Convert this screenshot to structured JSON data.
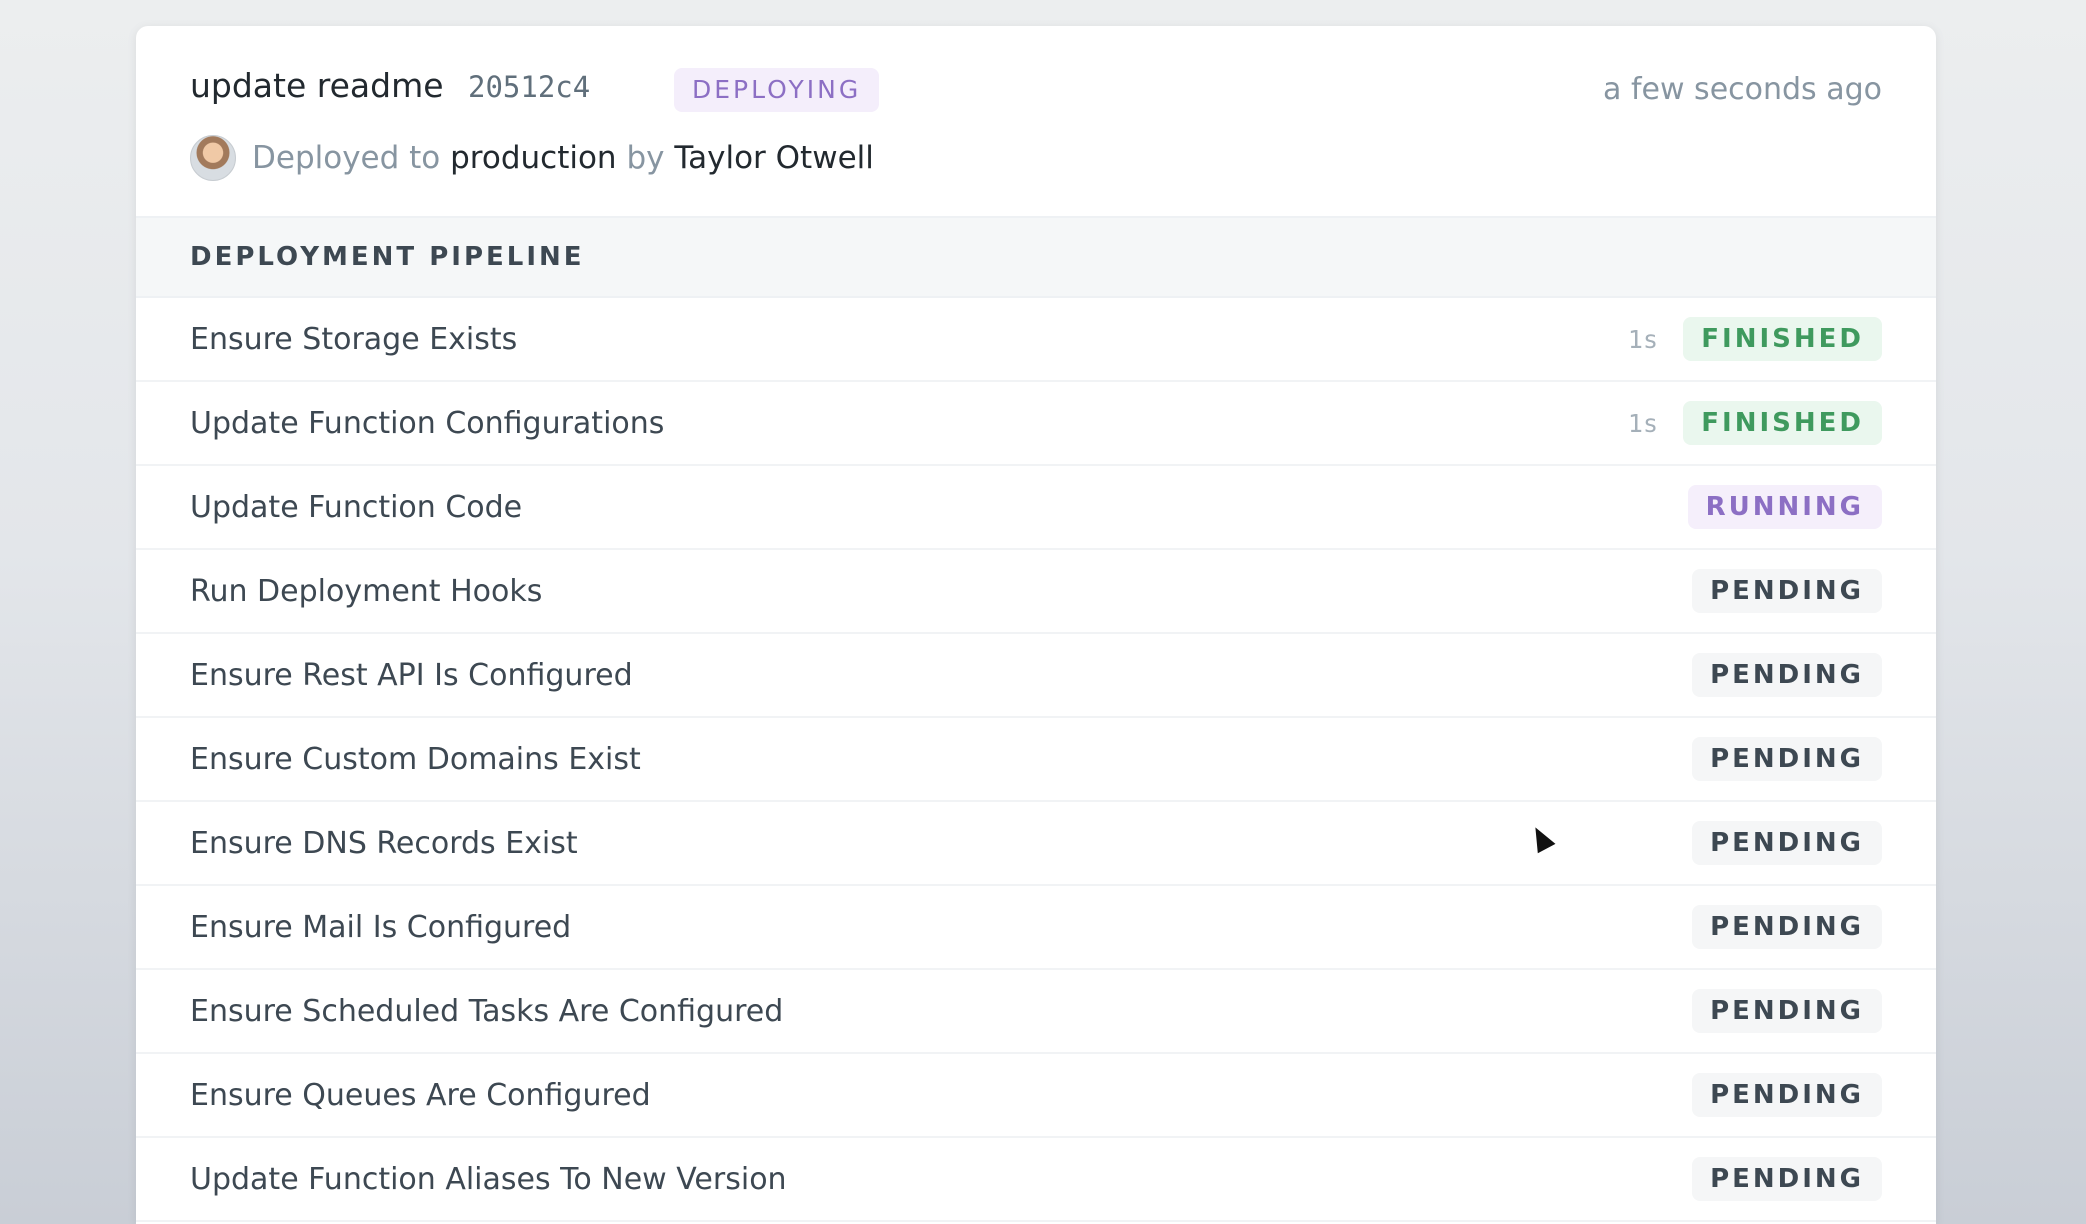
{
  "deployment": {
    "message": "update readme",
    "commit": "20512c4",
    "status": "DEPLOYING",
    "time": "a few seconds ago",
    "meta": {
      "prefix": "Deployed to ",
      "environment": "production",
      "by": " by ",
      "user": "Taylor Otwell"
    }
  },
  "pipeline": {
    "title": "DEPLOYMENT PIPELINE",
    "steps": [
      {
        "label": "Ensure Storage Exists",
        "duration": "1s",
        "status": "FINISHED"
      },
      {
        "label": "Update Function Configurations",
        "duration": "1s",
        "status": "FINISHED"
      },
      {
        "label": "Update Function Code",
        "duration": "",
        "status": "RUNNING"
      },
      {
        "label": "Run Deployment Hooks",
        "duration": "",
        "status": "PENDING"
      },
      {
        "label": "Ensure Rest API Is Configured",
        "duration": "",
        "status": "PENDING"
      },
      {
        "label": "Ensure Custom Domains Exist",
        "duration": "",
        "status": "PENDING"
      },
      {
        "label": "Ensure DNS Records Exist",
        "duration": "",
        "status": "PENDING"
      },
      {
        "label": "Ensure Mail Is Configured",
        "duration": "",
        "status": "PENDING"
      },
      {
        "label": "Ensure Scheduled Tasks Are Configured",
        "duration": "",
        "status": "PENDING"
      },
      {
        "label": "Ensure Queues Are Configured",
        "duration": "",
        "status": "PENDING"
      },
      {
        "label": "Update Function Aliases To New Version",
        "duration": "",
        "status": "PENDING"
      }
    ]
  },
  "colors": {
    "finished": "#3f9a5e",
    "running": "#8c6fc4",
    "pending": "#3d4852"
  }
}
